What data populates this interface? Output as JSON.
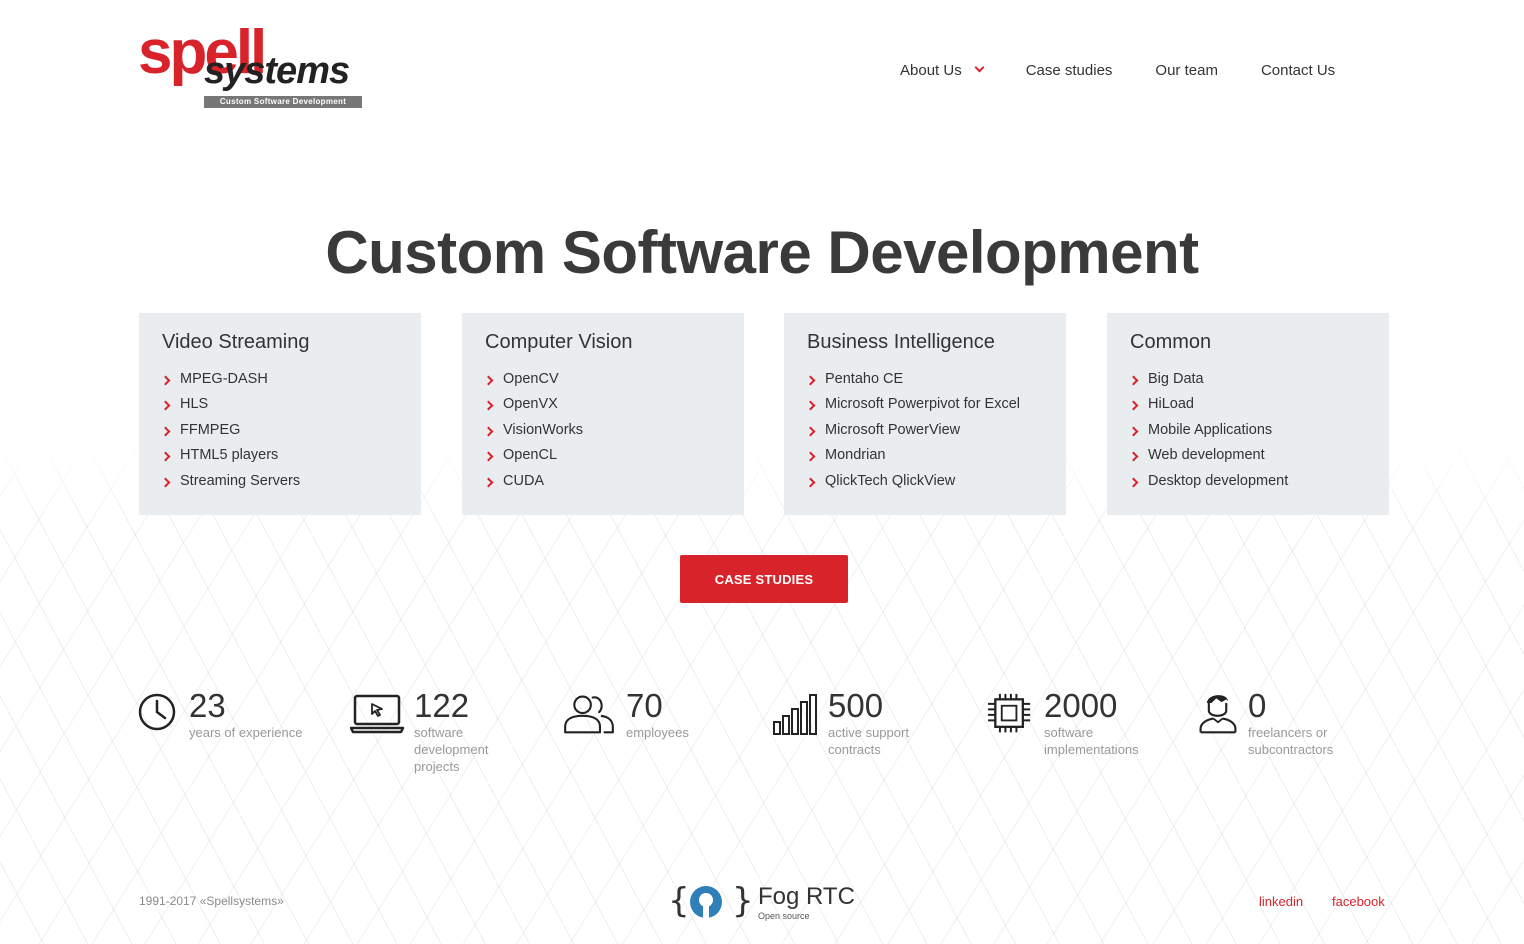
{
  "logo": {
    "word1": "spell",
    "word2": "systems",
    "tagline": "Custom Software Development"
  },
  "nav": [
    {
      "label": "About Us",
      "has_dropdown": true
    },
    {
      "label": "Case studies"
    },
    {
      "label": "Our team"
    },
    {
      "label": "Contact Us"
    }
  ],
  "hero": {
    "title": "Custom Software Development"
  },
  "cards": [
    {
      "title": "Video Streaming",
      "items": [
        "MPEG-DASH",
        "HLS",
        "FFMPEG",
        "HTML5 players",
        "Streaming Servers"
      ]
    },
    {
      "title": "Computer Vision",
      "items": [
        "OpenCV",
        "OpenVX",
        "VisionWorks",
        "OpenCL",
        "CUDA"
      ]
    },
    {
      "title": "Business Intelligence",
      "items": [
        "Pentaho CE",
        "Microsoft Powerpivot for Excel",
        "Microsoft PowerView",
        "Mondrian",
        "QlickTech QlickView"
      ]
    },
    {
      "title": "Common",
      "items": [
        "Big Data",
        "HiLoad",
        "Mobile Applications",
        "Web development",
        "Desktop development"
      ]
    }
  ],
  "cta": {
    "label": "CASE STUDIES"
  },
  "stats": [
    {
      "icon": "clock-icon",
      "value": "23",
      "label_lines": [
        "years of experience"
      ]
    },
    {
      "icon": "laptop-icon",
      "value": "122",
      "label_lines": [
        "software",
        "development",
        "projects"
      ]
    },
    {
      "icon": "people-icon",
      "value": "70",
      "label_lines": [
        "employees"
      ]
    },
    {
      "icon": "bar-chart-icon",
      "value": "500",
      "label_lines": [
        "active support",
        "contracts"
      ]
    },
    {
      "icon": "chip-icon",
      "value": "2000",
      "label_lines": [
        "software",
        "implementations"
      ]
    },
    {
      "icon": "person-icon",
      "value": "0",
      "label_lines": [
        "freelancers or",
        "subcontractors"
      ]
    }
  ],
  "footer": {
    "copyright": "1991-2017 «Spellsystems»",
    "fog": {
      "name": "Fog RTC",
      "sub": "Open source",
      "brace_open": "{",
      "brace_close": "}"
    },
    "links": [
      "linkedin",
      "facebook"
    ]
  },
  "colors": {
    "accent": "#d8232a",
    "card_bg": "#eaedf0",
    "text": "#333333",
    "muted": "#999999"
  }
}
